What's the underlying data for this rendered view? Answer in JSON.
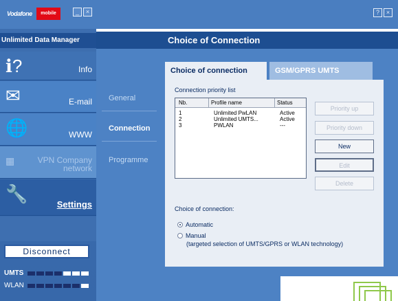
{
  "sidebar": {
    "logo_text": "Vodafone",
    "logo_badge": "mobile",
    "window_buttons": [
      "_",
      "×"
    ],
    "app_title": "Unlimited Data Manager",
    "nav": [
      {
        "label": "Info",
        "icon": "info-icon"
      },
      {
        "label": "E-mail",
        "icon": "email-icon"
      },
      {
        "label": "WWW",
        "icon": "globe-icon"
      },
      {
        "label": "VPN Company network",
        "label_line1": "VPN Company",
        "label_line2": "network",
        "icon": "vpn-icon"
      },
      {
        "label": "Settings",
        "icon": "wrench-icon"
      }
    ],
    "disconnect_label": "Disconnect",
    "signals": [
      {
        "label": "UMTS",
        "bars_on": 4,
        "bars_total": 7
      },
      {
        "label": "WLAN",
        "bars_on": 6,
        "bars_total": 7
      }
    ]
  },
  "header": {
    "help_buttons": [
      "?",
      "×"
    ],
    "section_title": "Choice of Connection"
  },
  "subnav": {
    "items": [
      "General",
      "Connection",
      "Programme"
    ],
    "active": "Connection"
  },
  "panel": {
    "tabs": [
      {
        "label": "Choice of connection",
        "active": true
      },
      {
        "label": "GSM/GPRS UMTS",
        "active": false
      }
    ],
    "list_label": "Connection priority list",
    "columns": [
      "Nb.",
      "Profile name",
      "Status"
    ],
    "rows": [
      {
        "nb": "1",
        "name": "Unlimited PwLAN",
        "status": "Active"
      },
      {
        "nb": "2",
        "name": "Unlimited UMTS...",
        "status": "Active"
      },
      {
        "nb": "3",
        "name": "PWLAN",
        "status": "---"
      }
    ],
    "buttons": {
      "priority_up": "Priority up",
      "priority_down": "Priority down",
      "new": "New",
      "edit": "Edit",
      "delete": "Delete"
    },
    "choice_label": "Choice of connection:",
    "radios": {
      "automatic": "Automatic",
      "manual": "Manual",
      "manual_desc": "(targeted selection of UMTS/GPRS or WLAN technology)",
      "selected": "automatic"
    }
  },
  "colors": {
    "sidebar_blue": "#3e6fb0",
    "title_bar": "#1d4e91",
    "panel_bg": "#e9eef5",
    "accent_red": "#e20a16",
    "accent_green": "#8fc84a"
  }
}
